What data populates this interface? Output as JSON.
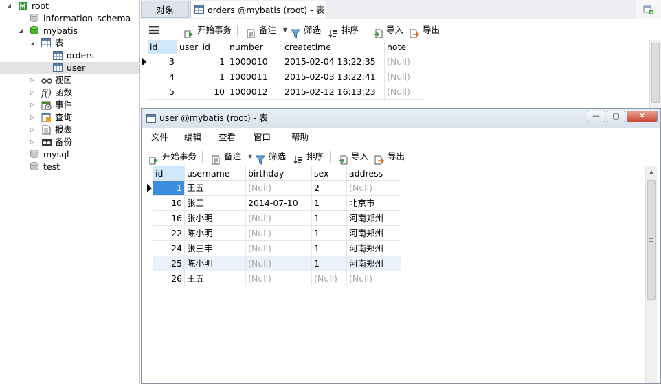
{
  "tree": {
    "items": [
      {
        "label": "root",
        "icon": "connection-icon",
        "twisty": "open",
        "indent": 0
      },
      {
        "label": "information_schema",
        "icon": "database-icon-grey",
        "twisty": "",
        "indent": 1
      },
      {
        "label": "mybatis",
        "icon": "database-icon-green",
        "twisty": "open",
        "indent": 1
      },
      {
        "label": "表",
        "icon": "table-folder-icon",
        "twisty": "open",
        "indent": 2
      },
      {
        "label": "orders",
        "icon": "table-icon",
        "twisty": "",
        "indent": 3
      },
      {
        "label": "user",
        "icon": "table-icon",
        "twisty": "",
        "indent": 3,
        "selected": true
      },
      {
        "label": "视图",
        "icon": "view-icon",
        "twisty": "closed",
        "indent": 2
      },
      {
        "label": "函数",
        "icon": "function-icon",
        "twisty": "closed",
        "indent": 2
      },
      {
        "label": "事件",
        "icon": "event-icon",
        "twisty": "closed",
        "indent": 2
      },
      {
        "label": "查询",
        "icon": "query-icon",
        "twisty": "closed",
        "indent": 2
      },
      {
        "label": "报表",
        "icon": "report-icon",
        "twisty": "closed",
        "indent": 2
      },
      {
        "label": "备份",
        "icon": "backup-icon",
        "twisty": "closed",
        "indent": 2
      },
      {
        "label": "mysql",
        "icon": "database-icon-grey",
        "twisty": "",
        "indent": 1
      },
      {
        "label": "test",
        "icon": "database-icon-grey",
        "twisty": "",
        "indent": 1
      }
    ]
  },
  "tabs": {
    "objects": "对象",
    "orders": "orders @mybatis (root) - 表"
  },
  "toolbar": {
    "begin_tx": "开始事务",
    "memo": "备注",
    "filter": "筛选",
    "sort": "排序",
    "import": "导入",
    "export": "导出"
  },
  "orders": {
    "columns": [
      "id",
      "user_id",
      "number",
      "createtime",
      "note"
    ],
    "rows": [
      [
        "3",
        "1",
        "1000010",
        "2015-02-04 13:22:35",
        "(Null)"
      ],
      [
        "4",
        "1",
        "1000011",
        "2015-02-03 13:22:41",
        "(Null)"
      ],
      [
        "5",
        "10",
        "1000012",
        "2015-02-12 16:13:23",
        "(Null)"
      ]
    ]
  },
  "user_window": {
    "title": "user @mybatis (root) - 表",
    "menu": [
      "文件",
      "编辑",
      "查看",
      "窗口",
      "帮助"
    ],
    "columns": [
      "id",
      "username",
      "birthday",
      "sex",
      "address"
    ],
    "rows": [
      [
        "1",
        "王五",
        "(Null)",
        "2",
        "(Null)"
      ],
      [
        "10",
        "张三",
        "2014-07-10",
        "1",
        "北京市"
      ],
      [
        "16",
        "张小明",
        "(Null)",
        "1",
        "河南郑州"
      ],
      [
        "22",
        "陈小明",
        "(Null)",
        "1",
        "河南郑州"
      ],
      [
        "24",
        "张三丰",
        "(Null)",
        "1",
        "河南郑州"
      ],
      [
        "25",
        "陈小明",
        "(Null)",
        "1",
        "河南郑州"
      ],
      [
        "26",
        "王五",
        "(Null)",
        "(Null)",
        "(Null)"
      ]
    ]
  },
  "colors": {
    "header_active": "#cfe8fb",
    "focus_cell": "#3b8de0",
    "null_text": "#a9a9a9",
    "selected_row": "#eaf1fb"
  }
}
